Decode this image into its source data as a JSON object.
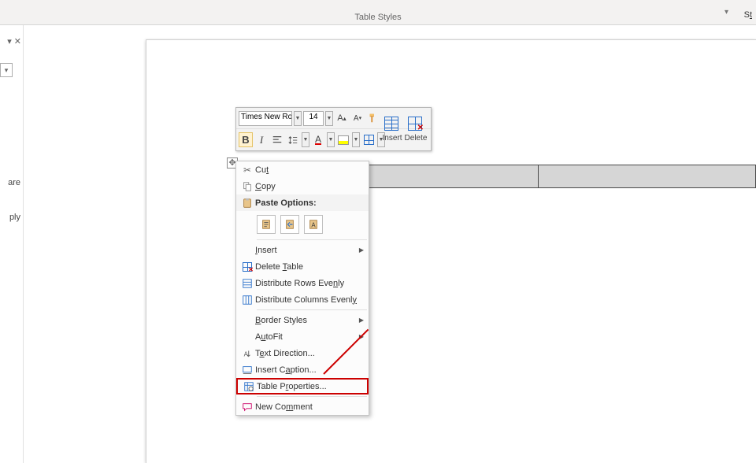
{
  "ribbon_group_label": "Table Styles",
  "left_panel": {
    "text_are": "are",
    "text_ply": "ply"
  },
  "mini_toolbar": {
    "font_name": "Times New Ro",
    "font_size": "14",
    "grow": "A↑",
    "shrink": "A↓",
    "bold": "B",
    "italic": "I",
    "insert_label": "Insert",
    "delete_label": "Delete"
  },
  "context_menu": {
    "cut": "Cut",
    "copy": "Copy",
    "paste_options_label": "Paste Options:",
    "insert": "Insert",
    "delete_table": "Delete Table",
    "dist_rows": "Distribute Rows Evenly",
    "dist_cols": "Distribute Columns Evenly",
    "border_styles": "Border Styles",
    "autofit": "AutoFit",
    "text_direction": "Text Direction...",
    "insert_caption": "Insert Caption...",
    "table_properties": "Table Properties...",
    "new_comment": "New Comment"
  }
}
